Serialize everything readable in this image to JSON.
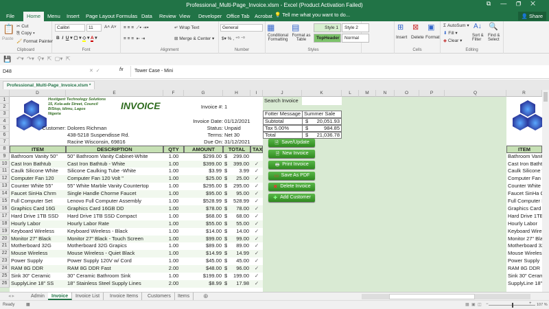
{
  "window": {
    "title": "Professional_Multi-Page_Invoice.xlsm - Excel (Product Activation Failed)",
    "controls": [
      "⧉",
      "—",
      "❐",
      "✕"
    ]
  },
  "ribbon_tabs": [
    "File",
    "Home",
    "Menu",
    "Insert",
    "Page Layout",
    "Formulas",
    "Data",
    "Review",
    "View",
    "Developer",
    "Office Tab",
    "Acrobat"
  ],
  "tell_me": "Tell me what you want to do...",
  "share": "Share",
  "clipboard": {
    "paste": "Paste",
    "cut": "Cut",
    "copy": "Copy",
    "format_painter": "Format Painter",
    "label": "Clipboard"
  },
  "font": {
    "name": "Calibri",
    "size": "11",
    "label": "Font"
  },
  "alignment": {
    "wrap": "Wrap Text",
    "merge": "Merge & Center",
    "label": "Alignment"
  },
  "number": {
    "format": "General",
    "label": "Number"
  },
  "styles": {
    "conditional": "Conditional Formatting",
    "format_table": "Format as Table",
    "style1": "Style 1",
    "style2": "Style 2",
    "topheader": "TopHeader",
    "normal": "Normal",
    "label": "Styles"
  },
  "cells": {
    "insert": "Insert",
    "delete": "Delete",
    "format": "Format",
    "label": "Cells"
  },
  "editing": {
    "autosum": "AutoSum",
    "fill": "Fill",
    "clear": "Clear",
    "sort": "Sort & Filter",
    "find": "Find & Select",
    "label": "Editing"
  },
  "formula_bar": {
    "name_box": "D48",
    "fx": "fx",
    "value": "Tower Case - Mini"
  },
  "workbook_tab": "Professional_Multi-Page_Invoice.xlsm *",
  "columns": [
    "D",
    "E",
    "F",
    "G",
    "H",
    "I",
    "J",
    "K",
    "L",
    "M",
    "N",
    "O",
    "P",
    "Q",
    "R"
  ],
  "company": {
    "name": "Hostigent Technology Solutions",
    "line1": "15, Kola-ade Street, Council",
    "line2": "B/Stop, Idimu, Lagos",
    "line3": "Nigeria"
  },
  "invoice": {
    "title": "INVOICE",
    "number_label": "Invoice #:",
    "number": "1",
    "date_label": "Invoice Date:",
    "date": "01/12/2021",
    "status_label": "Status:",
    "status": "Unpaid",
    "terms_label": "Terms:",
    "terms": "Net 30",
    "due_label": "Due On:",
    "due": "31/12/2021",
    "customer_label": "Customer:",
    "customer": "Dolores Richman",
    "addr1": "438-5218 Suspendisse Rd.",
    "addr2": "Racine Wisconsin, 69816"
  },
  "table_headers": [
    "ITEM",
    "DESCRIPTION",
    "QTY",
    "AMOUNT",
    "TOTAL",
    "TAX"
  ],
  "items": [
    [
      "Bathroom Vanity 50\"",
      "50\" Bathroom Vanity Cabinet-White",
      "1.00",
      "$299.00",
      "$",
      "299.00",
      ""
    ],
    [
      "Cast Iron Bathtub",
      "Cast Iron Bathtub - White",
      "1.00",
      "$399.00",
      "$",
      "399.00",
      "✓"
    ],
    [
      "Caulk Silicone White",
      "Silicone Caulking Tube -White",
      "1.00",
      "$3.99",
      "$",
      "3.99",
      "✓"
    ],
    [
      "Computer Fan 120",
      "Computer Fan 120 Volt \"",
      "1.00",
      "$25.00",
      "$",
      "25.00",
      "✓"
    ],
    [
      "Counter White 55\"",
      "55\" White Marble Vanity Countertop",
      "1.00",
      "$295.00",
      "$",
      "295.00",
      "✓"
    ],
    [
      "Faucet SinHa Chrm",
      "Single Handle Chorme Faucet",
      "1.00",
      "$95.00",
      "$",
      "95.00",
      "✓"
    ],
    [
      "Full Computer Set",
      "Lenovo Full Computer Assembly",
      "1.00",
      "$528.99",
      "$",
      "528.99",
      "✓"
    ],
    [
      "Graphics Card 16G",
      "Graphics Card 16GB DD",
      "1.00",
      "$78.00",
      "$",
      "78.00",
      "✓"
    ],
    [
      "Hard Drive 1TB SSD",
      "Hard Drive 1TB SSD Compact",
      "1.00",
      "$68.00",
      "$",
      "68.00",
      "✓"
    ],
    [
      "Hourly Labor",
      "Hourly Labor Rate",
      "1.00",
      "$55.00",
      "$",
      "55.00",
      "✓"
    ],
    [
      "Keyboard Wireless",
      "Keyboard Wireless - Black",
      "1.00",
      "$14.00",
      "$",
      "14.00",
      "✓"
    ],
    [
      "Monitor 27\" Black",
      "Monitor 27\" Black - Touch Screen",
      "1.00",
      "$99.00",
      "$",
      "99.00",
      "✓"
    ],
    [
      "Motherboard 32G",
      "Motherboard 32G Grapics",
      "1.00",
      "$89.00",
      "$",
      "89.00",
      "✓"
    ],
    [
      "Mouse Wireless",
      "Mouse Wireless - Quiet Black",
      "1.00",
      "$14.99",
      "$",
      "14.99",
      "✓"
    ],
    [
      "Power Supply",
      "Power Supply 120V w/ Cord",
      "1.00",
      "$45.00",
      "$",
      "45.00",
      "✓"
    ],
    [
      "RAM 8G DDR",
      "RAM 8G DDR Fast",
      "2.00",
      "$48.00",
      "$",
      "96.00",
      "✓"
    ],
    [
      "Sink 30\" Ceramic",
      "30\" Ceramic Bathroom Sink",
      "1.00",
      "$199.00",
      "$",
      "199.00",
      "✓"
    ],
    [
      "SupplyLine 18\" SS",
      "18\" Stainless Steel Supply Lines",
      "2.00",
      "$8.99",
      "$",
      "17.98",
      "✓"
    ]
  ],
  "side_panel": {
    "search_label": "Search Invoice",
    "search_value": "",
    "footer_label": "Fotter Message",
    "footer_value": "Summer Sale",
    "subtotal_label": "Subtotal",
    "subtotal": "20,051.93",
    "tax_label": "Tax 5.00%",
    "tax": "984.85",
    "total_label": "Total",
    "total": "21,036.78",
    "currency": "$"
  },
  "buttons": [
    "Save/Update",
    "New Invoice",
    "Print Invoice",
    "Save As PDF",
    "Delete Invoice",
    "Add Customer"
  ],
  "sheet_tabs": [
    "Admin",
    "Invoice",
    "Invoice List",
    "Invoice Items",
    "Customers",
    "Items"
  ],
  "active_sheet": "Invoice",
  "status": {
    "ready": "Ready",
    "zoom": "107 %"
  },
  "colors": {
    "excel_green": "#217346",
    "sheet_bg": "#d9ead3",
    "header_green": "#c6e0b4",
    "button_green": "#3c9a2c",
    "logo_blue": "#2f3fa8"
  }
}
